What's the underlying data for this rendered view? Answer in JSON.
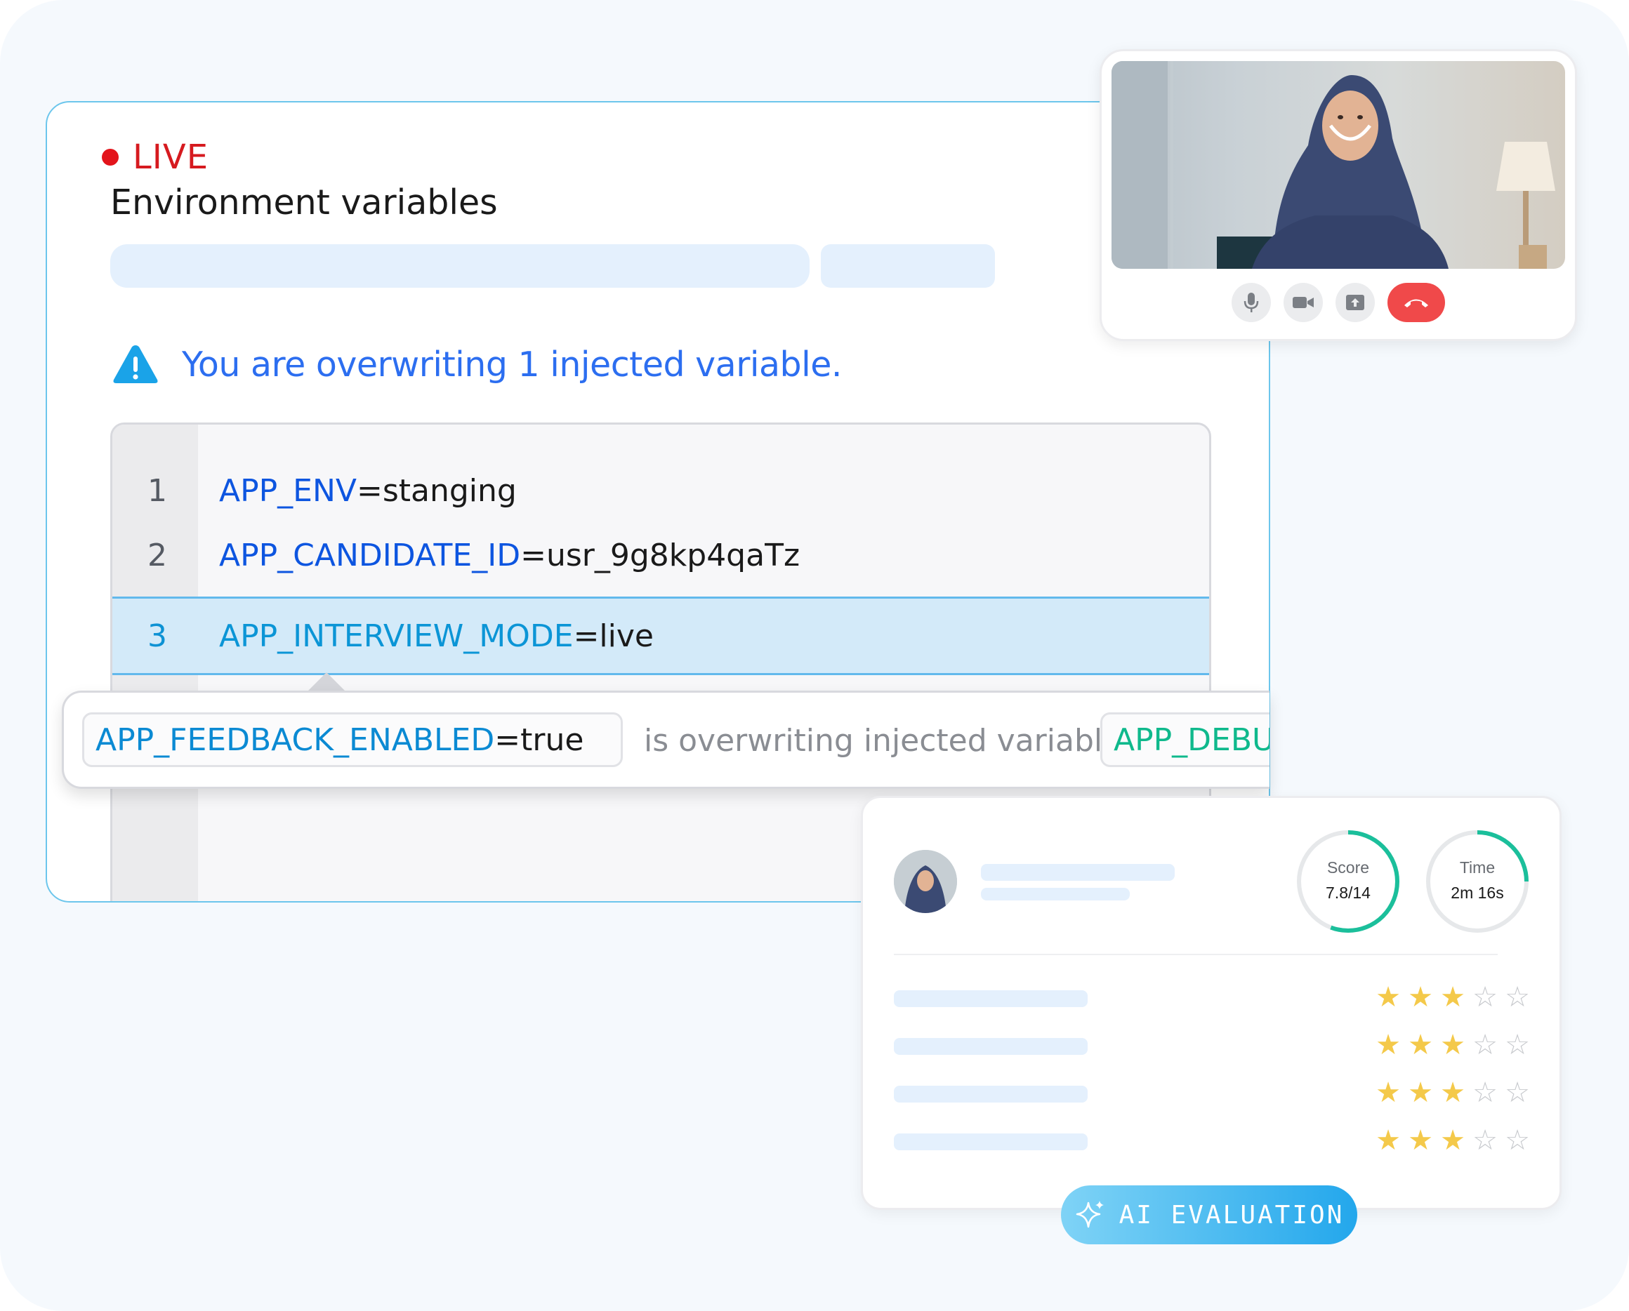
{
  "live_label": "LIVE",
  "panel_title": "Environment variables",
  "warning": "You are overwriting 1 injected variable.",
  "editor_lines": [
    {
      "number": "1",
      "key": "APP_ENV",
      "value": "=stanging"
    },
    {
      "number": "2",
      "key": "APP_CANDIDATE_ID",
      "value": "=usr_9g8kp4qaTz"
    },
    {
      "number": "3",
      "key": "APP_INTERVIEW_MODE",
      "value": "=live"
    }
  ],
  "tooltip": {
    "key": "APP_FEEDBACK_ENABLED",
    "value": "=true",
    "message": "is overwriting injected variable",
    "target": "APP_DEBUG"
  },
  "evaluation": {
    "score": {
      "label": "Score",
      "value": "7.8/14",
      "fraction": 0.557
    },
    "time": {
      "label": "Time",
      "value": "2m 16s",
      "fraction": 0.25
    },
    "ratings": [
      3,
      3,
      3,
      3
    ],
    "rating_max": 5,
    "badge": "AI EVALUATION"
  },
  "colors": {
    "live": "#e3141b",
    "accent": "#2c6ef0",
    "ring_progress": "#1bbf9b",
    "end_call": "#f0494a"
  },
  "icons": [
    "alert-triangle-icon",
    "microphone-icon",
    "camera-icon",
    "screen-share-icon",
    "hang-up-icon",
    "sparkle-icon",
    "star-icon"
  ]
}
